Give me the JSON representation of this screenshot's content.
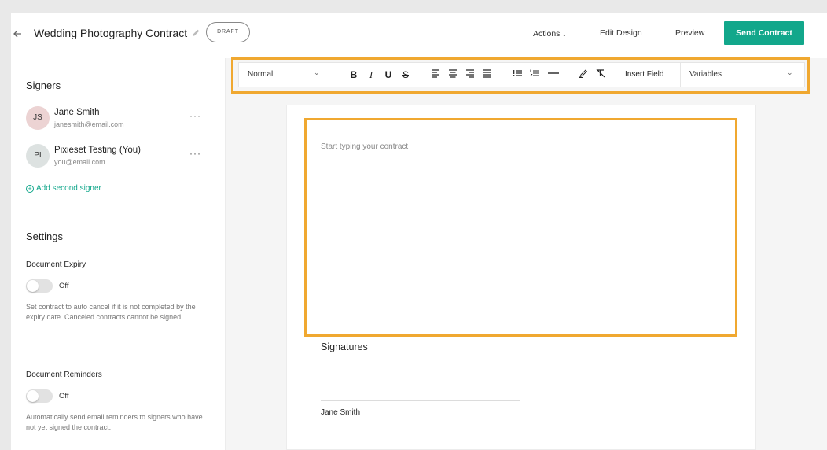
{
  "header": {
    "title": "Wedding Photography Contract",
    "status_badge": "DRAFT",
    "nav": {
      "actions": "Actions",
      "edit_design": "Edit Design",
      "preview": "Preview"
    },
    "send_button": "Send Contract",
    "accent_color": "#12a78b"
  },
  "sidebar": {
    "signers_title": "Signers",
    "signers": [
      {
        "initials": "JS",
        "name": "Jane Smith",
        "email": "janesmith@email.com",
        "avatar_color": "#ecd3d3"
      },
      {
        "initials": "PI",
        "name": "Pixieset Testing (You)",
        "email": "you@email.com",
        "avatar_color": "#dde2e1"
      }
    ],
    "add_signer": "Add second signer",
    "settings_title": "Settings",
    "settings": [
      {
        "label": "Document Expiry",
        "state": "Off",
        "description": "Set contract to auto cancel if it is not completed by the expiry date. Canceled contracts cannot be signed."
      },
      {
        "label": "Document Reminders",
        "state": "Off",
        "description": "Automatically send email reminders to signers who have not yet signed the contract."
      }
    ]
  },
  "toolbar": {
    "style_select": "Normal",
    "format_buttons": [
      {
        "label": "B",
        "icon": "bold-icon"
      },
      {
        "label": "I",
        "icon": "italic-icon"
      },
      {
        "label": "U",
        "icon": "underline-icon"
      },
      {
        "label": "S",
        "icon": "strikethrough-icon"
      }
    ],
    "insert_field": "Insert Field",
    "variables_select": "Variables",
    "highlight_color": "#f0a830"
  },
  "document": {
    "placeholder": "Start typing your contract",
    "signatures_title": "Signatures",
    "signature_name": "Jane Smith"
  }
}
